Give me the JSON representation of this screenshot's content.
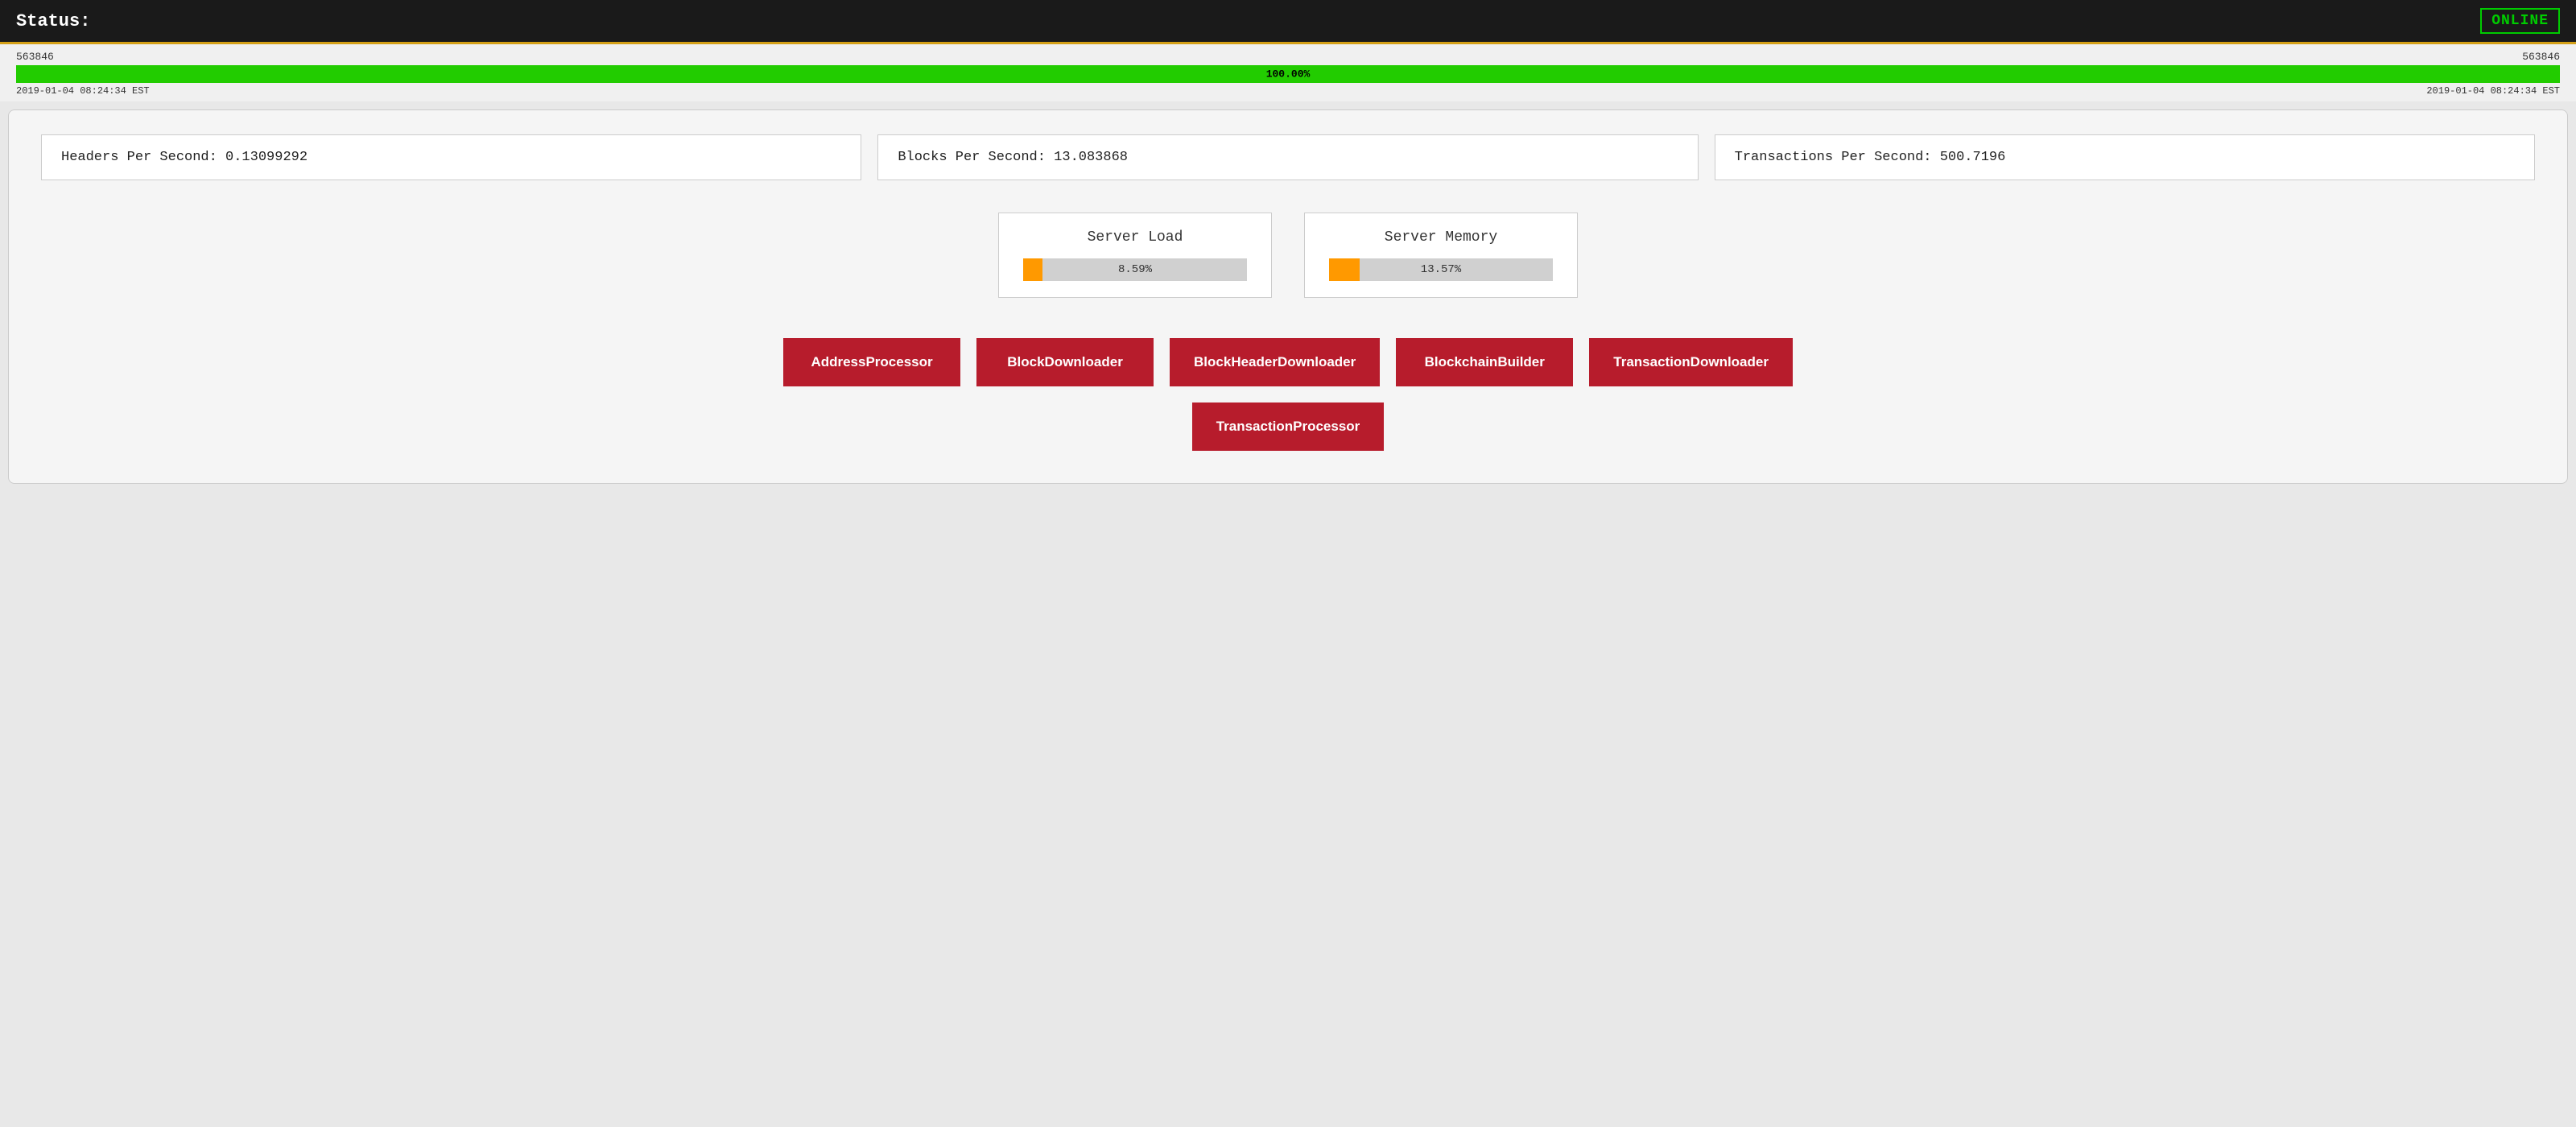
{
  "header": {
    "status_label": "Status:",
    "online_badge": "ONLINE"
  },
  "progress": {
    "left_number": "563846",
    "right_number": "563846",
    "percentage": "100.00%",
    "left_date": "2019-01-04 08:24:34 EST",
    "right_date": "2019-01-04 08:24:34 EST",
    "fill_width": "100"
  },
  "stats": [
    {
      "label": "Headers Per Second:",
      "value": "0.13099292"
    },
    {
      "label": "Blocks Per Second:",
      "value": "13.083868"
    },
    {
      "label": "Transactions Per Second:",
      "value": "500.7196"
    }
  ],
  "metrics": [
    {
      "title": "Server Load",
      "percentage": "8.59%",
      "fill_width": "8.59",
      "bar_label": "8.59%"
    },
    {
      "title": "Server Memory",
      "percentage": "13.57%",
      "fill_width": "13.57",
      "bar_label": "13.57%"
    }
  ],
  "processors": {
    "row1": [
      "AddressProcessor",
      "BlockDownloader",
      "BlockHeaderDownloader",
      "BlockchainBuilder",
      "TransactionDownloader"
    ],
    "row2": [
      "TransactionProcessor"
    ]
  }
}
